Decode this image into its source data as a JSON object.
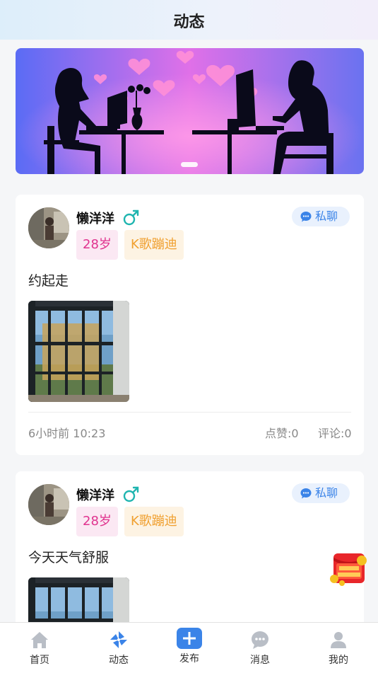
{
  "header": {
    "title": "动态"
  },
  "posts": [
    {
      "username": "懒洋洋",
      "age_tag": "28岁",
      "hobby_tag": "K歌蹦迪",
      "chat_label": "私聊",
      "content": "约起走",
      "time": "6小时前 10:23",
      "likes": "点赞:0",
      "comments": "评论:0"
    },
    {
      "username": "懒洋洋",
      "age_tag": "28岁",
      "hobby_tag": "K歌蹦迪",
      "chat_label": "私聊",
      "content": "今天天气舒服"
    }
  ],
  "tabbar": [
    {
      "label": "首页",
      "icon": "home-icon",
      "active": false
    },
    {
      "label": "动态",
      "icon": "pinwheel-icon",
      "active": true
    },
    {
      "label": "发布",
      "icon": "plus-icon",
      "active": false
    },
    {
      "label": "消息",
      "icon": "message-icon",
      "active": false
    },
    {
      "label": "我的",
      "icon": "user-icon",
      "active": false
    }
  ],
  "colors": {
    "accent": "#3b84e8",
    "age_tag": "#e0338f",
    "hobby_tag": "#f0a030",
    "male_symbol": "#1fb5b0"
  }
}
